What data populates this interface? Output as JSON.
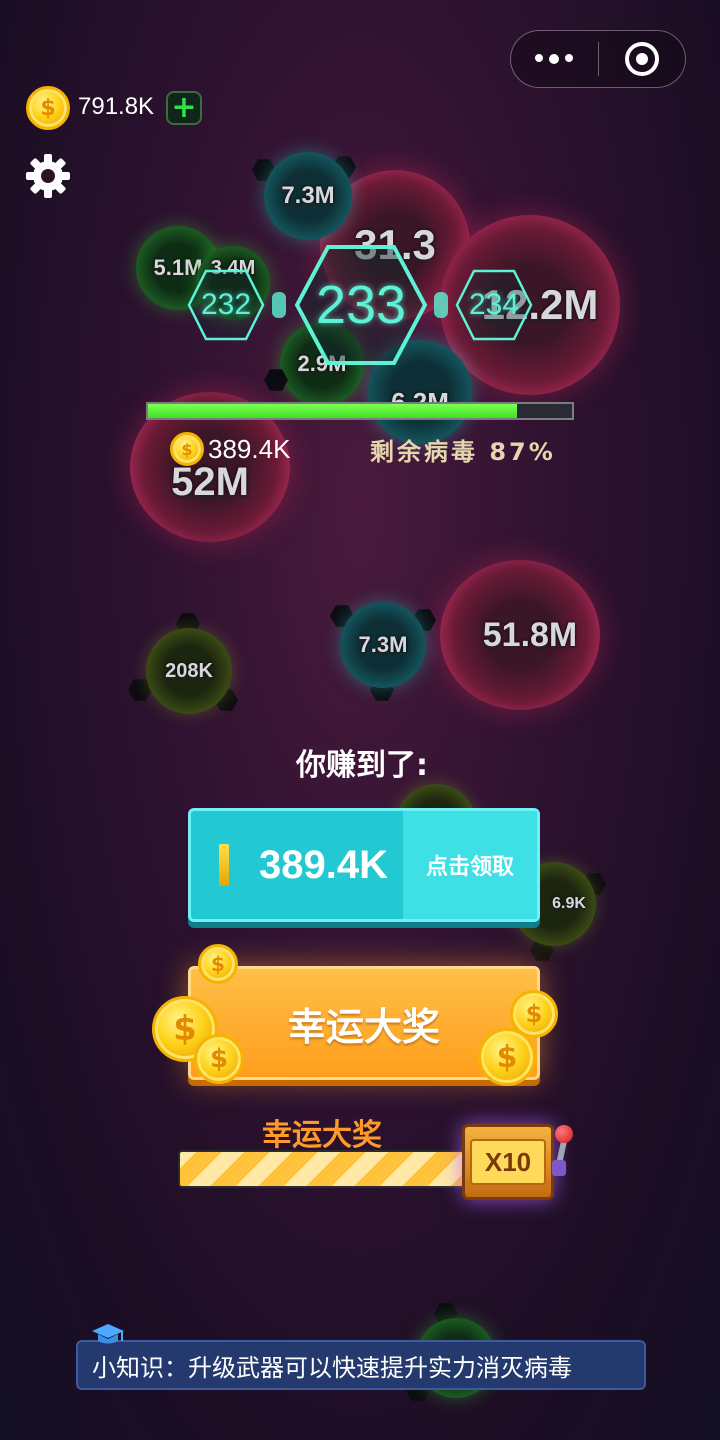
{
  "balance": {
    "amount": "791.8K",
    "add_label": "+"
  },
  "levels": {
    "prev": "232",
    "current": "233",
    "next": "234"
  },
  "progress": {
    "fill_fraction": 0.87,
    "remaining_label": "剩余病毒 87%"
  },
  "level_reward": {
    "amount": "389.4K"
  },
  "viruses": {
    "v1": "7.3M",
    "v2": "31.3",
    "v3": "5.1M",
    "v4": "3.4M",
    "v5": "12.2M",
    "v6": "2.9M",
    "v7": "6.2M",
    "v8": "52M",
    "v9": "208K",
    "v10": "7.3M",
    "v11": "51.8M",
    "v12": "6.9K"
  },
  "earned": {
    "title": "你赚到了:",
    "amount": "389.4K",
    "claim_label": "点击领取"
  },
  "jackpot": {
    "button_label": "幸运大奖",
    "bar_label": "幸运大奖",
    "multiplier": "X10"
  },
  "tip": {
    "text": "小知识：升级武器可以快速提升实力消灭病毒"
  },
  "colors": {
    "accent_cyan": "#22c8d2",
    "accent_orange": "#ff9e1c",
    "progress_green": "#3fe022"
  }
}
